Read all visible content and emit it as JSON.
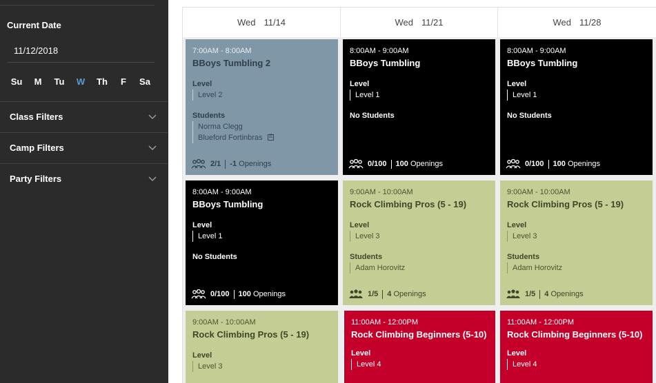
{
  "sidebar": {
    "current_date_label": "Current Date",
    "current_date_value": "11/12/2018",
    "days": [
      {
        "label": "Su",
        "active": false
      },
      {
        "label": "M",
        "active": false
      },
      {
        "label": "Tu",
        "active": false
      },
      {
        "label": "W",
        "active": true
      },
      {
        "label": "Th",
        "active": false
      },
      {
        "label": "F",
        "active": false
      },
      {
        "label": "Sa",
        "active": false
      }
    ],
    "filters": [
      {
        "label": "Class Filters",
        "icon": "chevron-down-icon"
      },
      {
        "label": "Camp Filters",
        "icon": "chevron-down-icon"
      },
      {
        "label": "Party Filters",
        "icon": "chevron-down-icon"
      }
    ]
  },
  "calendar": {
    "columns": [
      {
        "day": "Wed",
        "date": "11/14"
      },
      {
        "day": "Wed",
        "date": "11/21"
      },
      {
        "day": "Wed",
        "date": "11/28"
      }
    ],
    "cards": [
      {
        "time": "7:00AM - 8:00AM",
        "title": "BBoys Tumbling 2",
        "level_label": "Level",
        "level": "Level 2",
        "students_label": "Students",
        "students": [
          "Norma Clegg",
          "Blueford Fortinbras"
        ],
        "enrolled": "2/1",
        "openings_count": "-1",
        "openings_label": "Openings",
        "color": "#7f97a6"
      },
      {
        "time": "8:00AM - 9:00AM",
        "title": "BBoys Tumbling",
        "level_label": "Level",
        "level": "Level 1",
        "students_label": "No Students",
        "students": [],
        "enrolled": "0/100",
        "openings_count": "100",
        "openings_label": "Openings",
        "color": "#000000"
      },
      {
        "time": "8:00AM - 9:00AM",
        "title": "BBoys Tumbling",
        "level_label": "Level",
        "level": "Level 1",
        "students_label": "No Students",
        "students": [],
        "enrolled": "0/100",
        "openings_count": "100",
        "openings_label": "Openings",
        "color": "#000000"
      },
      {
        "time": "8:00AM - 9:00AM",
        "title": "BBoys Tumbling",
        "level_label": "Level",
        "level": "Level 1",
        "students_label": "No Students",
        "students": [],
        "enrolled": "0/100",
        "openings_count": "100",
        "openings_label": "Openings",
        "color": "#000000"
      },
      {
        "time": "9:00AM - 10:00AM",
        "title": "Rock Climbing Pros (5 - 19)",
        "level_label": "Level",
        "level": "Level 3",
        "students_label": "Students",
        "students": [
          "Adam Horovitz"
        ],
        "enrolled": "1/5",
        "openings_count": "4",
        "openings_label": "Openings",
        "color": "#c3cd94"
      },
      {
        "time": "9:00AM - 10:00AM",
        "title": "Rock Climbing Pros (5 - 19)",
        "level_label": "Level",
        "level": "Level 3",
        "students_label": "Students",
        "students": [
          "Adam Horovitz"
        ],
        "enrolled": "1/5",
        "openings_count": "4",
        "openings_label": "Openings",
        "color": "#c3cd94"
      },
      {
        "time": "9:00AM - 10:00AM",
        "title": "Rock Climbing Pros (5 - 19)",
        "level_label": "Level",
        "level": "Level 3",
        "color": "#c3cd94"
      },
      {
        "time": "11:00AM - 12:00PM",
        "title": "Rock Climbing Beginners (5-10)",
        "level_label": "Level",
        "level": "Level 4",
        "color": "#c4002a"
      },
      {
        "time": "11:00AM - 12:00PM",
        "title": "Rock Climbing Beginners (5-10)",
        "level_label": "Level",
        "level": "Level 4",
        "color": "#c4002a"
      }
    ]
  }
}
